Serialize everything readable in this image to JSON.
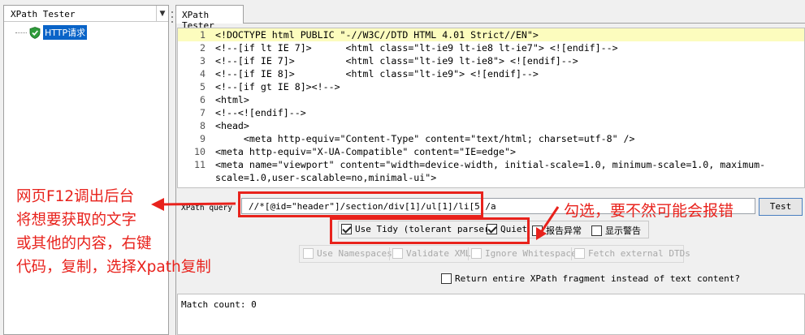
{
  "left_panel": {
    "title": "XPath Tester",
    "tree_item": "HTTP请求"
  },
  "tab": {
    "label": "XPath Tester"
  },
  "editor": {
    "lines": [
      {
        "n": "1",
        "text": "<!DOCTYPE html PUBLIC \"-//W3C//DTD HTML 4.01 Strict//EN\">"
      },
      {
        "n": "2",
        "text": "<!--[if lt IE 7]>      <html class=\"lt-ie9 lt-ie8 lt-ie7\"> <![endif]-->"
      },
      {
        "n": "3",
        "text": "<!--[if IE 7]>         <html class=\"lt-ie9 lt-ie8\"> <![endif]-->"
      },
      {
        "n": "4",
        "text": "<!--[if IE 8]>         <html class=\"lt-ie9\"> <![endif]-->"
      },
      {
        "n": "5",
        "text": "<!--[if gt IE 8]><!-->"
      },
      {
        "n": "6",
        "text": "<html>"
      },
      {
        "n": "7",
        "text": "<!--<![endif]-->"
      },
      {
        "n": "8",
        "text": "<head>"
      },
      {
        "n": "9",
        "text": "     <meta http-equiv=\"Content-Type\" content=\"text/html; charset=utf-8\" />"
      },
      {
        "n": "10",
        "text": "<meta http-equiv=\"X-UA-Compatible\" content=\"IE=edge\">"
      },
      {
        "n": "11",
        "text": "<meta name=\"viewport\" content=\"width=device-width, initial-scale=1.0, minimum-scale=1.0, maximum-"
      },
      {
        "n": "",
        "text": "scale=1.0,user-scalable=no,minimal-ui\">"
      }
    ]
  },
  "query": {
    "label": "XPath query :",
    "value": "//*[@id=\"header\"]/section/div[1]/ul[1]/li[5]/a",
    "test_button": "Test"
  },
  "options": {
    "use_tidy": "Use Tidy (tolerant parser)",
    "quiet": "Quiet",
    "report_errors": "报告异常",
    "show_warnings": "显示警告",
    "use_namespaces": "Use Namespaces",
    "validate_xml": "Validate XML",
    "ignore_whitespace": "Ignore Whitespace",
    "fetch_dtds": "Fetch external DTDs",
    "return_fragment": "Return entire XPath fragment instead of text content?"
  },
  "results": {
    "match_count": "Match count: 0"
  },
  "annotations": {
    "left": [
      "网页F12调出后台",
      "将想要获取的文字",
      "或其他的内容，右键",
      "代码，复制，选择Xpath复制"
    ],
    "right": "勾选，要不然可能会报错",
    "color": "#e8221c"
  }
}
